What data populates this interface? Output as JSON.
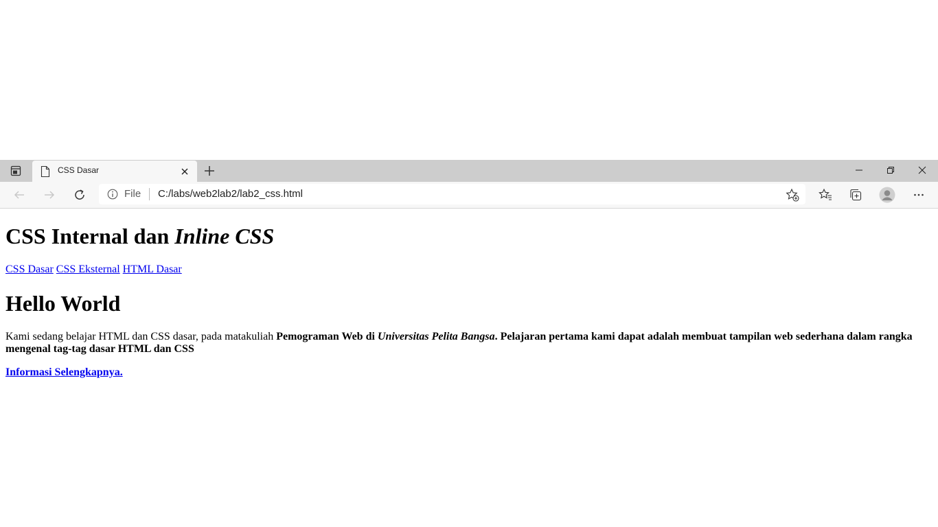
{
  "browser": {
    "tab": {
      "title": "CSS Dasar"
    },
    "address": {
      "scheme": "File",
      "url": "C:/labs/web2lab2/lab2_css.html"
    },
    "accent_color": "#0000ee"
  },
  "page": {
    "heading": {
      "plain": "CSS Internal dan ",
      "italic": "Inline CSS"
    },
    "nav_links": [
      "CSS Dasar",
      "CSS Eksternal",
      "HTML Dasar"
    ],
    "subheading": "Hello World",
    "paragraph": {
      "normal": "Kami sedang belajar HTML dan CSS dasar, pada matakuliah ",
      "bold_1": "Pemograman Web di ",
      "bold_italic": "Universitas Pelita Bangsa",
      "bold_2": ". Pelajaran pertama kami dapat adalah membuat tampilan web sederhana dalam rangka mengenal tag-tag dasar HTML dan CSS"
    },
    "more_link": "Informasi Selengkapnya."
  }
}
